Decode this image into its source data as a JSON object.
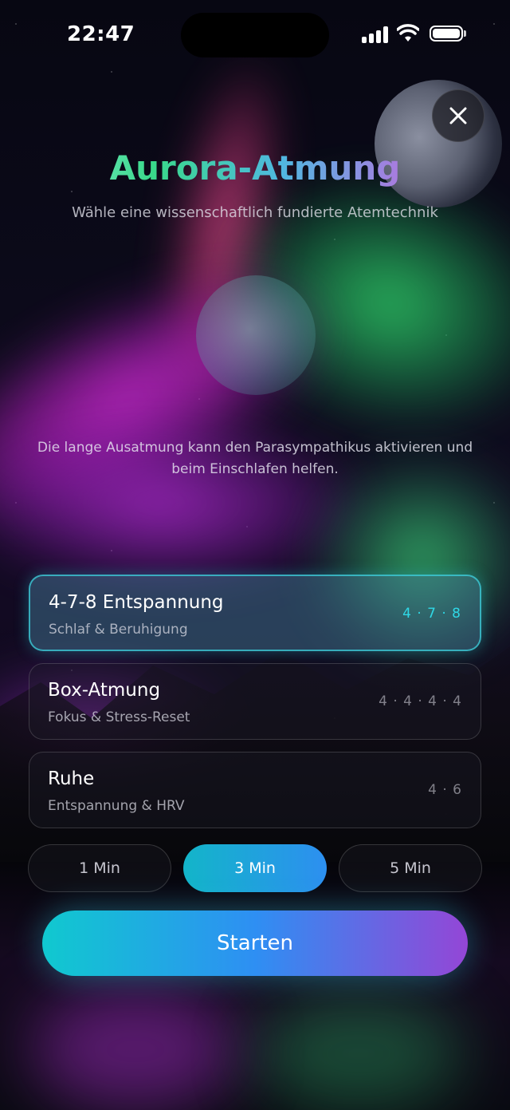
{
  "status_bar": {
    "time": "22:47",
    "icons": [
      "signal-icon",
      "wifi-icon",
      "battery-icon"
    ]
  },
  "close_icon": "close-icon",
  "header": {
    "title": "Aurora-Atmung",
    "subtitle": "Wähle eine wissenschaftlich fundierte Atemtechnik"
  },
  "description": "Die lange Ausatmung kann den Parasympathikus aktivieren und beim Einschlafen helfen.",
  "techniques": [
    {
      "name": "4-7-8 Entspannung",
      "subtitle": "Schlaf & Beruhigung",
      "pattern": "4 · 7 · 8",
      "selected": true
    },
    {
      "name": "Box-Atmung",
      "subtitle": "Fokus & Stress-Reset",
      "pattern": "4 · 4 · 4 · 4",
      "selected": false
    },
    {
      "name": "Ruhe",
      "subtitle": "Entspannung & HRV",
      "pattern": "4 · 6",
      "selected": false
    }
  ],
  "durations": [
    {
      "label": "1 Min",
      "selected": false
    },
    {
      "label": "3 Min",
      "selected": true
    },
    {
      "label": "5 Min",
      "selected": false
    }
  ],
  "start_button": "Starten",
  "colors": {
    "accent_cyan": "#10c9cf",
    "accent_blue": "#2e8ff3",
    "accent_purple": "#9446d6"
  }
}
